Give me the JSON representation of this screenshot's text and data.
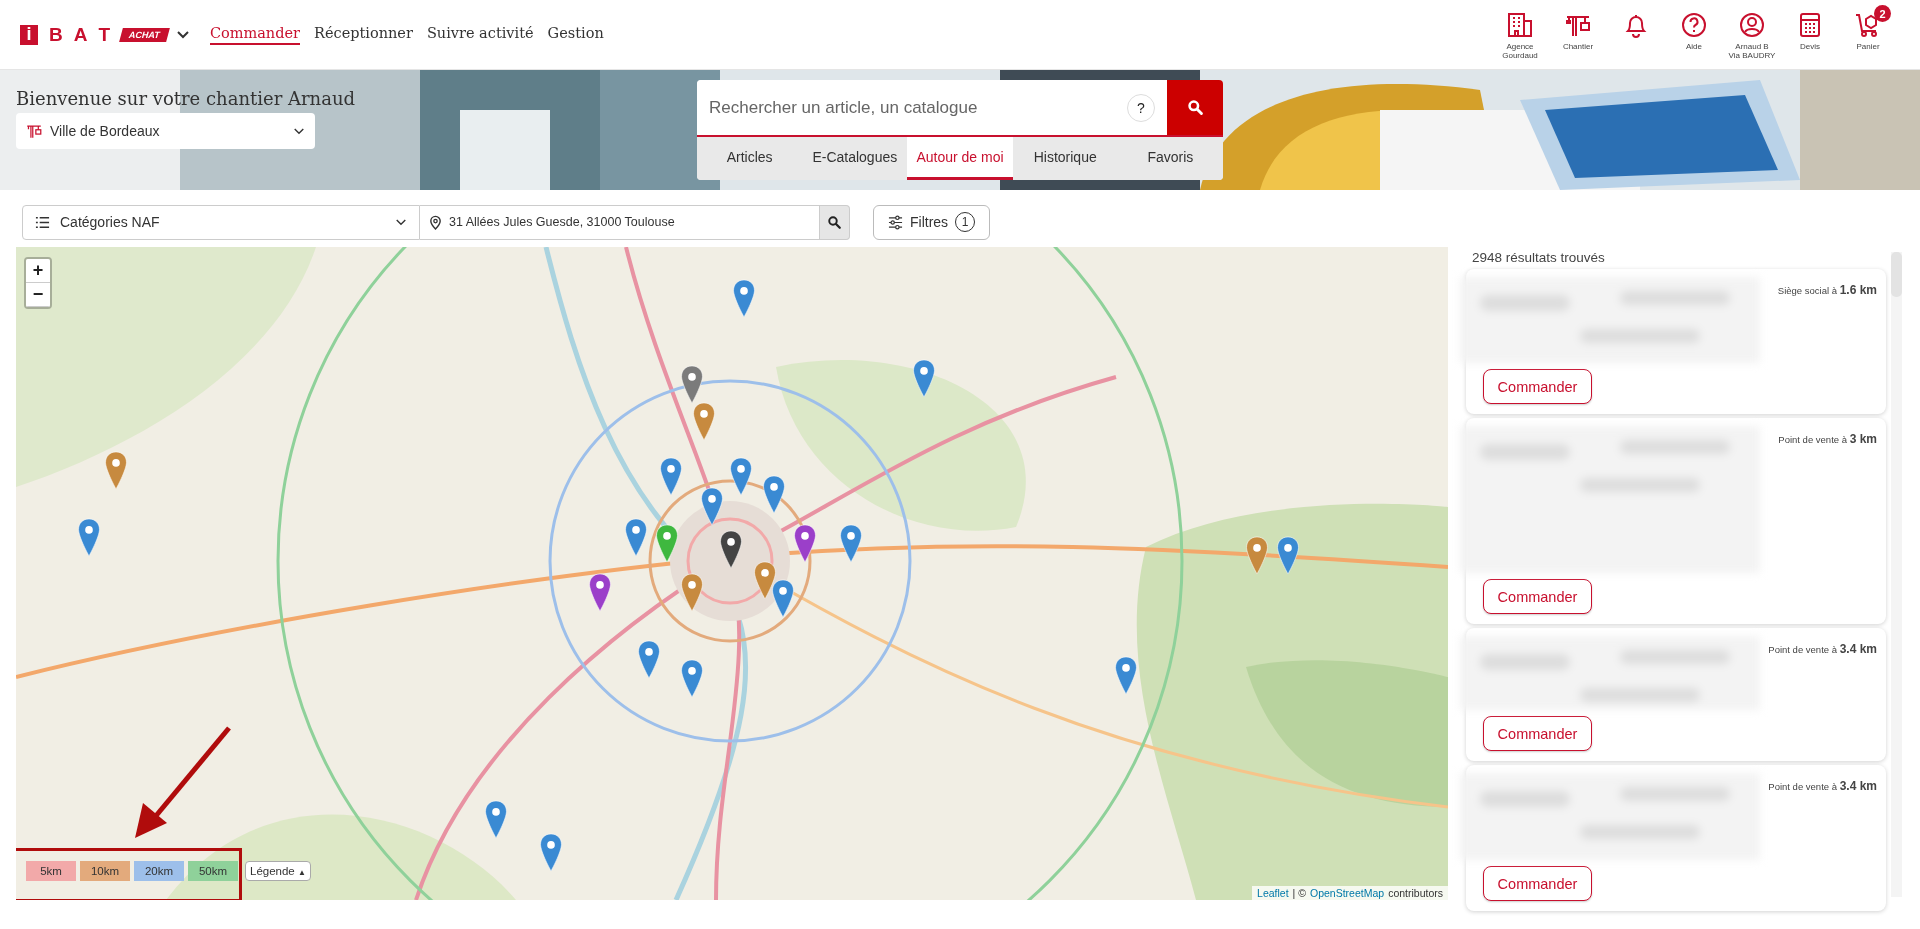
{
  "header": {
    "logo": {
      "letters": [
        "i",
        "B",
        "A",
        "T"
      ],
      "badge": "ACHAT"
    },
    "nav": [
      {
        "label": "Commander",
        "selected": true
      },
      {
        "label": "Réceptionner",
        "selected": false
      },
      {
        "label": "Suivre activité",
        "selected": false
      },
      {
        "label": "Gestion",
        "selected": false
      }
    ],
    "shortcuts": [
      {
        "kind": "building",
        "label": "Agence Gourdaud"
      },
      {
        "kind": "crane",
        "label": "Chantier"
      },
      {
        "kind": "bell"
      },
      {
        "kind": "help",
        "label": "Aide"
      },
      {
        "kind": "user",
        "label": "Arnaud B",
        "sublabel": "Via BAUDRY"
      },
      {
        "kind": "calculator",
        "label": "Devis"
      },
      {
        "kind": "cart",
        "label": "Panier",
        "badge": "2"
      }
    ]
  },
  "banner": {
    "welcome": "Bienvenue sur votre chantier Arnaud",
    "site_select": {
      "value": "Ville de Bordeaux"
    }
  },
  "search": {
    "placeholder": "Rechercher un article, un catalogue",
    "help": "?",
    "tabs": [
      {
        "label": "Articles",
        "selected": false
      },
      {
        "label": "E-Catalogues",
        "selected": false
      },
      {
        "label": "Autour de moi",
        "selected": true
      },
      {
        "label": "Historique",
        "selected": false
      },
      {
        "label": "Favoris",
        "selected": false
      }
    ]
  },
  "filters": {
    "category": {
      "value": "Catégories NAF"
    },
    "address": {
      "value": "31 Allées Jules Guesde, 31000 Toulouse"
    },
    "filters_button": {
      "label": "Filtres",
      "count": "1"
    }
  },
  "map": {
    "zoom": [
      "+",
      "−"
    ],
    "ranges": [
      {
        "label": "5km",
        "color": "#f2a9a9"
      },
      {
        "label": "10km",
        "color": "#e3aa7c"
      },
      {
        "label": "20km",
        "color": "#9dbfea"
      },
      {
        "label": "50km",
        "color": "#8fd19a"
      }
    ],
    "legend": {
      "label": "Légende",
      "toggle": "▲"
    },
    "markers": [
      {
        "color": "#3a8ad3"
      },
      {
        "color": "#3a8ad3"
      },
      {
        "color": "#c78a3f"
      },
      {
        "color": "#3a8ad3"
      },
      {
        "color": "#3a8ad3"
      },
      {
        "color": "#7b7b7b"
      },
      {
        "color": "#c78a3f"
      },
      {
        "color": "#3a8ad3"
      },
      {
        "color": "#3a8ad3"
      },
      {
        "color": "#3fb83f"
      },
      {
        "color": "#444444"
      },
      {
        "color": "#9b3fc9"
      },
      {
        "color": "#3a8ad3"
      },
      {
        "color": "#c78a3f"
      },
      {
        "color": "#3a8ad3"
      },
      {
        "color": "#c78a3f"
      },
      {
        "color": "#3a8ad3"
      },
      {
        "color": "#3a8ad3"
      },
      {
        "color": "#3a8ad3"
      },
      {
        "color": "#3a8ad3"
      },
      {
        "color": "#3a8ad3"
      },
      {
        "color": "#c78a3f"
      },
      {
        "color": "#3a8ad3"
      },
      {
        "color": "#3a8ad3"
      },
      {
        "color": "#9b3fc9"
      },
      {
        "color": "#3a8ad3"
      }
    ],
    "attribution": {
      "leaflet": "Leaflet",
      "separator": "| ©",
      "osm": "OpenStreetMap",
      "suffix": "contributors"
    },
    "annotation": {
      "color": "#b00c0c"
    }
  },
  "results": {
    "count_text": "2948 résultats trouvés",
    "cards": [
      {
        "distance": "Siège social à **1.6 km**",
        "button": "Commander"
      },
      {
        "distance": "Point de vente à **3 km**",
        "button": "Commander"
      },
      {
        "distance": "Point de vente à **3.4 km**",
        "button": "Commander"
      },
      {
        "distance": "Point de vente à **3.4 km**",
        "button": "Commander"
      }
    ]
  }
}
